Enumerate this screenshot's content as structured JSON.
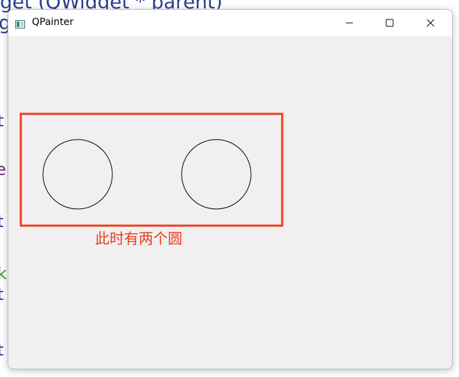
{
  "background_code": {
    "line1_text": "get (QWidget * parent)",
    "frag_ge": "ge",
    "frag_t1": "t",
    "frag_er": "er",
    "frag_t2": "t",
    "frag_k": "k",
    "frag_t3": "t",
    "frag_t4": "t"
  },
  "window": {
    "title": "QPainter",
    "icon": "qt-app-icon",
    "controls": [
      "minimize-icon",
      "maximize-icon",
      "close-icon"
    ]
  },
  "canvas": {
    "shapes": [
      "circle",
      "circle"
    ],
    "stroke_color": "#000000"
  },
  "annotation": {
    "color": "#ef3b1c",
    "text": "此时有两个圆"
  }
}
